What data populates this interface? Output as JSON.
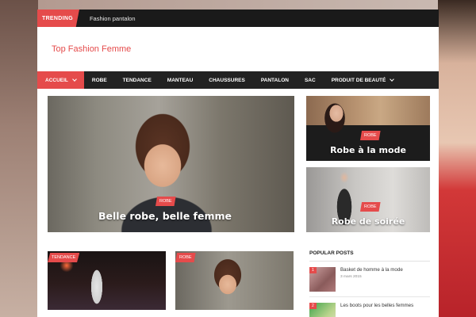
{
  "trending": {
    "badge": "TRENDING",
    "text": "Fashion pantalon"
  },
  "site": {
    "title": "Top Fashion Femme"
  },
  "nav": {
    "items": [
      {
        "label": "ACCUEIL"
      },
      {
        "label": "ROBE"
      },
      {
        "label": "TENDANCE"
      },
      {
        "label": "MANTEAU"
      },
      {
        "label": "CHAUSSURES"
      },
      {
        "label": "PANTALON"
      },
      {
        "label": "SAC"
      },
      {
        "label": "PRODUIT DE BEAUTÉ"
      }
    ]
  },
  "featured": {
    "main": {
      "category": "ROBE",
      "title": "Belle robe, belle femme"
    },
    "side": [
      {
        "category": "ROBE",
        "title": "Robe à la mode"
      },
      {
        "category": "ROBE",
        "title": "Robe de soirée"
      }
    ]
  },
  "grid": [
    {
      "category": "TENDANCE"
    },
    {
      "category": "ROBE"
    }
  ],
  "popular": {
    "heading": "POPULAR POSTS",
    "items": [
      {
        "num": "1",
        "title": "Basket de homme à la mode",
        "date": "3 mars 2015"
      },
      {
        "num": "2",
        "title": "Les boots pour les belles femmes",
        "date": ""
      }
    ]
  },
  "colors": {
    "accent": "#e54b4b",
    "dark": "#222222"
  }
}
